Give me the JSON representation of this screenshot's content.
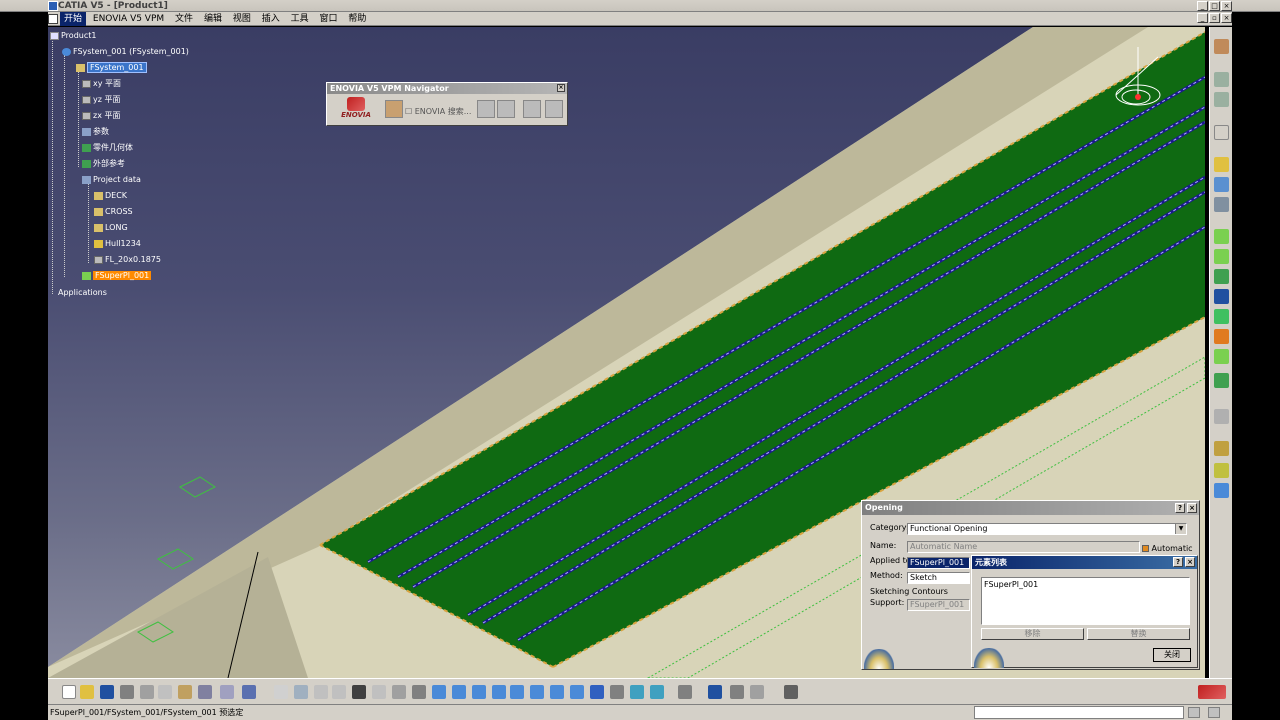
{
  "window": {
    "title": "CATIA V5 - [Product1]"
  },
  "menu": {
    "items": [
      "开始",
      "ENOVIA V5 VPM",
      "文件",
      "编辑",
      "视图",
      "插入",
      "工具",
      "窗口",
      "帮助"
    ]
  },
  "tree": {
    "root": "Product1",
    "system": "FSystem_001 (FSystem_001)",
    "selected": "FSystem_001",
    "xy": "xy 平面",
    "yz": "yz 平面",
    "zx": "zx 平面",
    "params": "参数",
    "geom": "零件几何体",
    "extref": "外部参考",
    "project": "Project data",
    "deck": "DECK",
    "cross": "CROSS",
    "long": "LONG",
    "hull": "Hull1234",
    "fl": "FL_20x0.1875",
    "superpl": "FSuperPl_001",
    "apps": "Applications"
  },
  "navigator": {
    "title": "ENOVIA V5 VPM Navigator",
    "logo_text": "ENOVIA",
    "check_label": "ENOVIA 搜索..."
  },
  "opening_dialog": {
    "title": "Opening",
    "category_label": "Category:",
    "category_value": "Functional Opening",
    "name_label": "Name:",
    "name_value": "Automatic Name",
    "automatic_label": "Automatic",
    "applied_label": "Applied to:",
    "applied_value": "FSuperPl_001",
    "method_label": "Method:",
    "method_value": "Sketch",
    "sketching_label": "Sketching Contours",
    "support_label": "Support:",
    "support_value": "FSuperPl_001"
  },
  "element_list": {
    "title": "元素列表",
    "items": [
      "FSuperPl_001"
    ],
    "remove_label": "移除",
    "replace_label": "替换",
    "close_label": "关闭"
  },
  "status": {
    "text": "FSuperPl_001/FSystem_001/FSystem_001 预选定"
  },
  "colors": {
    "deck_green": "#0f6a12",
    "stiffener_blue": "#1a1a8c",
    "hull_grey": "#d8d4b8",
    "chrome": "#d4d0c8",
    "highlight_orange": "#ff8a00"
  }
}
